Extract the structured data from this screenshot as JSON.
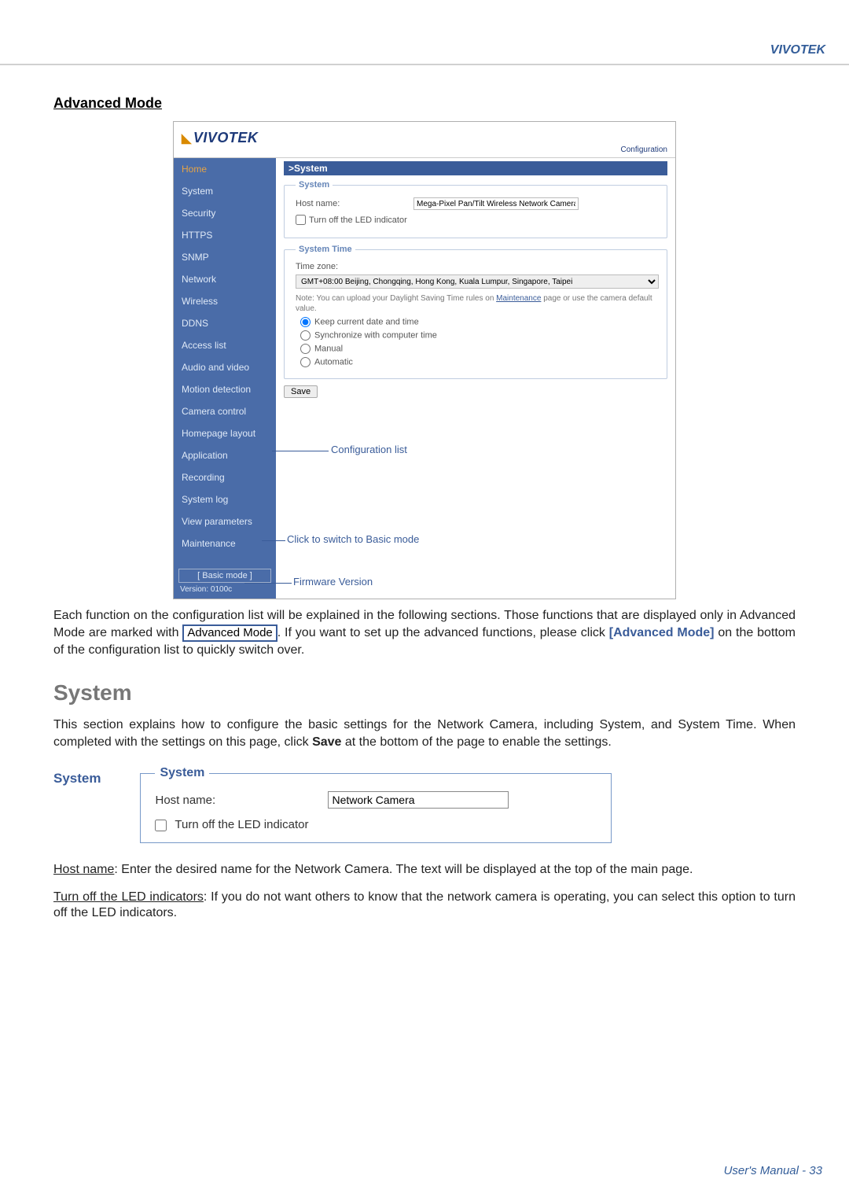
{
  "brand": "VIVOTEK",
  "doc": {
    "heading_advanced": "Advanced Mode",
    "screenshot": {
      "logo": "VIVOTEK",
      "conf_link": "Configuration",
      "breadcrumb": ">System",
      "sidebar": {
        "items": [
          "Home",
          "System",
          "Security",
          "HTTPS",
          "SNMP",
          "Network",
          "Wireless",
          "DDNS",
          "Access list",
          "Audio and video",
          "Motion detection",
          "Camera control",
          "Homepage layout",
          "Application",
          "Recording",
          "System log",
          "View parameters",
          "Maintenance"
        ],
        "basic_mode": "[ Basic mode ]",
        "version": "Version: 0100c"
      },
      "system_panel": {
        "legend": "System",
        "hostname_label": "Host name:",
        "hostname_value": "Mega-Pixel Pan/Tilt Wireless Network Camera",
        "led_label": "Turn off the LED indicator"
      },
      "time_panel": {
        "legend": "System Time",
        "tz_label": "Time zone:",
        "tz_value": "GMT+08:00 Beijing, Chongqing, Hong Kong, Kuala Lumpur, Singapore, Taipei",
        "note_prefix": "Note: You can upload your Daylight Saving Time rules on ",
        "note_link": "Maintenance",
        "note_suffix": " page or use the camera default value.",
        "radio1": "Keep current date and time",
        "radio2": "Synchronize with computer time",
        "radio3": "Manual",
        "radio4": "Automatic"
      },
      "save_button": "Save",
      "callouts": {
        "config_list": "Configuration list",
        "basic_mode": "Click to switch to Basic mode",
        "firmware": "Firmware Version"
      }
    },
    "para1_a": "Each function on the configuration list will be explained in the following sections. Those functions that are displayed only in Advanced Mode are marked with ",
    "para1_badge": "Advanced Mode",
    "para1_b": ". If you want to set up the advanced functions, please click ",
    "para1_bold": "[Advanced Mode]",
    "para1_c": " on the bottom of the configuration list to quickly switch over.",
    "system_heading": "System",
    "system_intro": "This section explains how to configure the basic settings for the Network Camera, including System, and System Time. When completed with the settings on this page, click Save at the bottom of the page to enable the settings.",
    "system_sub": "System",
    "system_panel2": {
      "legend": "System",
      "hostname_label": "Host name:",
      "hostname_value": "Network Camera",
      "led_label": "Turn off the LED indicator"
    },
    "hostname_desc_u": "Host name",
    "hostname_desc": ": Enter the desired name for the Network Camera. The text will be displayed at the top of the main page.",
    "led_desc_u": "Turn off the LED indicators",
    "led_desc": ": If you do not want others to know that the network camera is operating, you can select this option to turn off the LED indicators.",
    "footer": "User's Manual - 33"
  }
}
